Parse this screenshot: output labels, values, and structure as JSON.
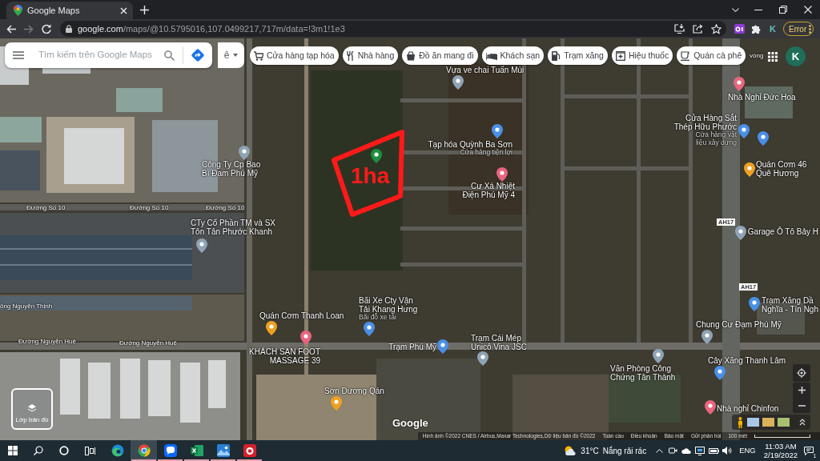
{
  "browser": {
    "tab_title": "Google Maps",
    "url_host": "google.com",
    "url_path": "/maps/@10.5795016,107.0499217,717m/data=!3m1!1e3",
    "profile_initial": "K",
    "menu_status": "Error"
  },
  "maps": {
    "search": {
      "placeholder": "Tìm kiếm trên Google Maps"
    },
    "input_tool": "ê",
    "chips": [
      {
        "kind": "grocery",
        "label": "Cửa hàng tạp hóa"
      },
      {
        "kind": "restaurant",
        "label": "Nhà hàng"
      },
      {
        "kind": "takeout",
        "label": "Đồ ăn mang đi"
      },
      {
        "kind": "hotel",
        "label": "Khách sạn"
      },
      {
        "kind": "gas",
        "label": "Trạm xăng"
      },
      {
        "kind": "pharmacy",
        "label": "Hiệu thuốc"
      },
      {
        "kind": "cafe",
        "label": "Quán cà phê"
      }
    ],
    "account_initial": "K",
    "places": [
      {
        "name_lines": [
          "Vựa ve chai Tuấn Mùi"
        ],
        "color": "#8fa3b5"
      },
      {
        "name_lines": [
          "Nhà Nghỉ Đức Hoa"
        ],
        "color": "#e9657f"
      },
      {
        "name_lines": [
          "Cửa Hàng Sắt",
          "Thép Hữu Phước"
        ],
        "category_lines": [
          "Cửa hàng vật",
          "liệu xây dựng"
        ],
        "color": "#4a8fe7"
      },
      {
        "color": "#4a8fe7"
      },
      {
        "name_lines": [
          "Tạp hóa Quỳnh Ba Sơn"
        ],
        "category_lines": [
          "Cửa hàng tiện lợi"
        ],
        "color": "#4a8fe7"
      },
      {
        "name_lines": [
          "Công Ty Cp Bao",
          "Bì Đạm Phú Mỹ"
        ],
        "color": "#8fa3b5"
      },
      {
        "name_lines": [
          "Quán Cơm 46",
          "Quê Hương"
        ],
        "color": "#f0a020"
      },
      {
        "color": "#1e8e3e"
      },
      {
        "name_lines": [
          "Cư Xá Nhiệt",
          "Điện Phú Mỹ 4"
        ],
        "color": "#e9657f"
      },
      {
        "name_lines": [
          "CTy Cổ Phần TM và SX",
          "Tôn Tân Phước Khanh"
        ],
        "color": "#8fa3b5"
      },
      {
        "name_lines": [
          "Garage Ô Tô Bảy H"
        ],
        "color": "#8fa3b5"
      },
      {
        "name_lines": [
          "Bãi Xe Cty Vận",
          "Tải Khang Hưng"
        ],
        "category_lines": [
          "Bãi đỗ xe tải"
        ],
        "color": "#4a8fe7"
      },
      {
        "name_lines": [
          "Trạm Xăng Dầ",
          "Nghĩa - Tín Ngh"
        ],
        "color": "#4a8fe7"
      },
      {
        "name_lines": [
          "Quán Cơm Thanh Loan"
        ],
        "color": "#f0a020"
      },
      {
        "name_lines": [
          "Chung Cư Đạm Phú Mỹ"
        ],
        "color": "#8fa3b5"
      },
      {
        "name_lines": [
          "KHÁCH SẠN FOOT",
          "MASSAGE 39"
        ],
        "color": "#e9657f"
      },
      {
        "name_lines": [
          "Trạm Phú Mỹ"
        ],
        "color": "#4a8fe7"
      },
      {
        "name_lines": [
          "Trạm Cái Mép",
          "Unicô Vina JSC"
        ],
        "color": "#8fa3b5"
      },
      {
        "name_lines": [
          "Văn Phòng Công",
          "Chứng Tân Thành"
        ],
        "color": "#8fa3b5"
      },
      {
        "name_lines": [
          "Cây Xăng Thanh Lâm"
        ],
        "color": "#4a8fe7"
      },
      {
        "name_lines": [
          "Sơn Dương Qán"
        ],
        "color": "#f0a020"
      },
      {
        "name_lines": [
          "Nhà nghỉ Chinfon"
        ],
        "color": "#e9657f"
      }
    ],
    "road_labels": [
      "vòng",
      "Đường Số 10",
      "Đường Số 10",
      "Đường Số 10",
      "ông Nguyễn Thịnh",
      "Đường Nguyễn Huệ",
      "Đường Nguyễn Huệ"
    ],
    "road_shields": [
      "AH17",
      "AH17"
    ],
    "annotation": "1ha",
    "layers_button": "Lớp bản đồ",
    "logo": "Google",
    "attribution": "Hình ảnh ©2022 CNES / Airbus,Maxar Technologies,Dữ liệu bản đồ ©2022",
    "footer_links": [
      "Toàn cầu",
      "Điều khoản",
      "Bảo mật",
      "Gửi phản hồi"
    ],
    "scale_label": "100 mét"
  },
  "taskbar": {
    "apps": [
      {
        "kind": "edge",
        "selected": false,
        "running": false
      },
      {
        "kind": "chrome",
        "selected": true,
        "running": true
      },
      {
        "kind": "zalo",
        "selected": false,
        "running": true
      },
      {
        "kind": "excel",
        "selected": false,
        "running": true
      },
      {
        "kind": "photos",
        "selected": false,
        "running": true
      },
      {
        "kind": "recorder",
        "selected": false,
        "running": true
      }
    ],
    "weather": {
      "temperature": "31°C",
      "condition": "Nắng rải rác"
    },
    "language": "ENG",
    "time": "11:03 AM",
    "date": "2/19/2022",
    "notification_count": "1"
  }
}
